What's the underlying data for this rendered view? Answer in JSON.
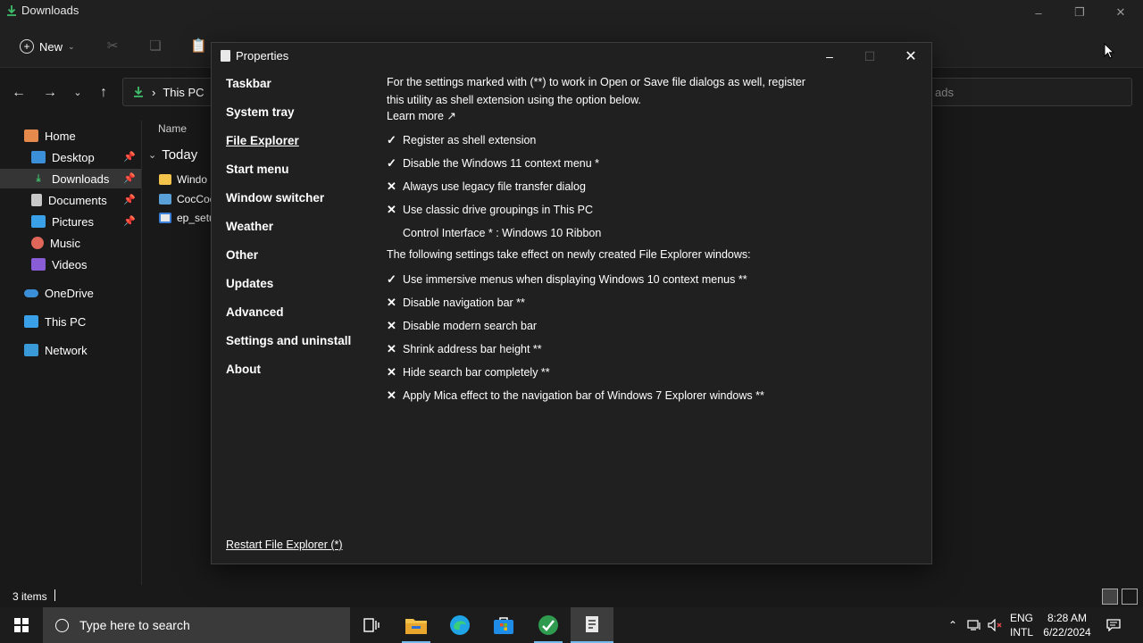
{
  "explorer": {
    "title": "Downloads",
    "new_label": "New",
    "address": {
      "segment": "This PC",
      "separator": "›"
    },
    "search_placeholder_fragment": "ads",
    "sidebar": [
      {
        "label": "Home",
        "icon": "home-icon"
      },
      {
        "label": "Desktop",
        "icon": "desktop-icon",
        "pinned": true
      },
      {
        "label": "Downloads",
        "icon": "downloads-icon",
        "pinned": true,
        "selected": true
      },
      {
        "label": "Documents",
        "icon": "documents-icon",
        "pinned": true
      },
      {
        "label": "Pictures",
        "icon": "pictures-icon",
        "pinned": true
      },
      {
        "label": "Music",
        "icon": "music-icon"
      },
      {
        "label": "Videos",
        "icon": "videos-icon"
      },
      {
        "label": "OneDrive",
        "icon": "onedrive-icon"
      },
      {
        "label": "This PC",
        "icon": "this-pc-icon"
      },
      {
        "label": "Network",
        "icon": "network-icon"
      }
    ],
    "column_name": "Name",
    "group_label": "Today",
    "files": [
      "Windo",
      "CocCoc",
      "ep_setu"
    ],
    "status": "3 items"
  },
  "dialog": {
    "title": "Properties",
    "nav": [
      "Taskbar",
      "System tray",
      "File Explorer",
      "Start menu",
      "Window switcher",
      "Weather",
      "Other",
      "Updates",
      "Advanced",
      "Settings and uninstall",
      "About"
    ],
    "active_nav": "File Explorer",
    "intro": "For the settings marked with (**) to work in Open or Save file dialogs as well, register this utility as shell extension using the option below.",
    "learn_more": "Learn more ↗",
    "options": [
      {
        "mark": "✓",
        "label": "Register as shell extension"
      },
      {
        "mark": "✓",
        "label": "Disable the Windows 11 context menu *"
      },
      {
        "mark": "✕",
        "label": "Always use legacy file transfer dialog"
      },
      {
        "mark": "✕",
        "label": "Use classic drive groupings in This PC"
      },
      {
        "mark": "",
        "label": "Control Interface * : Windows 10 Ribbon"
      }
    ],
    "note": "The following settings take effect on newly created File Explorer windows:",
    "options2": [
      {
        "mark": "✓",
        "label": "Use immersive menus when displaying Windows 10 context menus **"
      },
      {
        "mark": "✕",
        "label": "Disable navigation bar **"
      },
      {
        "mark": "✕",
        "label": "Disable modern search bar"
      },
      {
        "mark": "✕",
        "label": "Shrink address bar height **"
      },
      {
        "mark": "✕",
        "label": "Hide search bar completely **"
      },
      {
        "mark": "✕",
        "label": "Apply Mica effect to the navigation bar of Windows 7 Explorer windows **"
      }
    ],
    "restart": "Restart File Explorer (*)"
  },
  "taskbar": {
    "search_placeholder": "Type here to search",
    "lang_line1": "ENG",
    "lang_line2": "INTL",
    "time": "8:28 AM",
    "date": "6/22/2024"
  },
  "colors": {
    "accent": "#76b9ed",
    "downloads_green": "#3fbf6b",
    "folder_yellow": "#f3c24a"
  }
}
